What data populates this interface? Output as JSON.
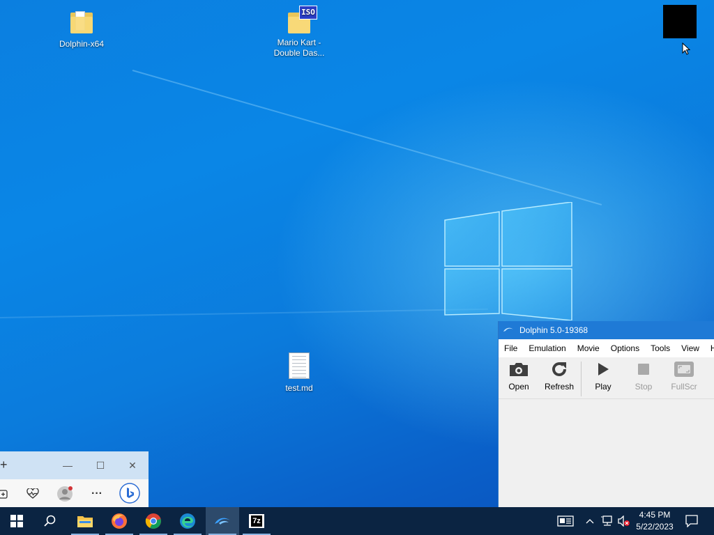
{
  "desktop": {
    "icons": [
      {
        "label": "Dolphin-x64"
      },
      {
        "label": "Mario Kart -\nDouble Das..."
      },
      {
        "label": "test.md"
      }
    ],
    "iso_badge": "ISO"
  },
  "dolphin_window": {
    "title": "Dolphin 5.0-19368",
    "menu": [
      "File",
      "Emulation",
      "Movie",
      "Options",
      "Tools",
      "View",
      "H"
    ],
    "toolbar": [
      {
        "label": "Open",
        "icon": "camera-icon",
        "enabled": true
      },
      {
        "label": "Refresh",
        "icon": "refresh-icon",
        "enabled": true
      },
      {
        "label": "Play",
        "icon": "play-icon",
        "enabled": true
      },
      {
        "label": "Stop",
        "icon": "stop-icon",
        "enabled": false
      },
      {
        "label": "FullScr",
        "icon": "fullscreen-icon",
        "enabled": false
      }
    ]
  },
  "edge_window": {
    "new_tab": "+",
    "minimize": "—",
    "maximize": "☐",
    "close": "✕",
    "more": "···"
  },
  "taskbar": {
    "apps": [
      "start-icon",
      "search-icon",
      "file-explorer-icon",
      "firefox-icon",
      "chrome-icon",
      "edge-icon",
      "dolphin-icon",
      "7zip-icon"
    ],
    "sevenzip_label": "7z",
    "time": "4:45 PM",
    "date": "5/22/2023"
  },
  "colors": {
    "taskbar": "#0b2442",
    "dolphin_title": "#1f7ad6",
    "wallpaper": "#0a78d7"
  }
}
